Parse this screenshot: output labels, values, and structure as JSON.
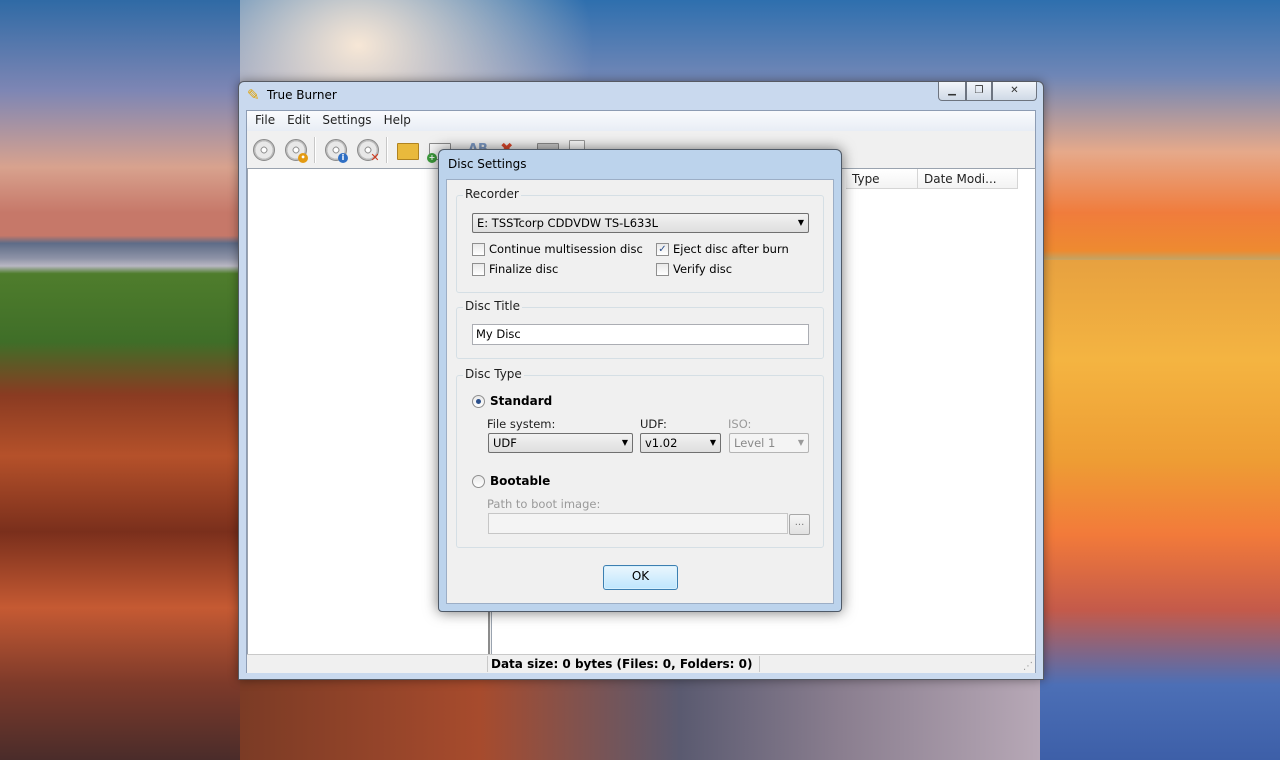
{
  "main_window": {
    "title": "True Burner",
    "menu": [
      "File",
      "Edit",
      "Settings",
      "Help"
    ],
    "toolbar_text": {
      "rename": "AB"
    },
    "columns": {
      "type": "Type",
      "date_modified": "Date Modi..."
    },
    "status": "Data size: 0 bytes (Files: 0, Folders: 0)"
  },
  "dialog": {
    "title": "Disc Settings",
    "recorder": {
      "label": "Recorder",
      "device": "E: TSSTcorp CDDVDW TS-L633L",
      "continue_multisession": "Continue multisession disc",
      "eject_after_burn": "Eject disc after burn",
      "finalize": "Finalize disc",
      "verify": "Verify disc"
    },
    "disc_title": {
      "label": "Disc Title",
      "value": "My Disc"
    },
    "disc_type": {
      "label": "Disc Type",
      "standard": "Standard",
      "file_system_label": "File system:",
      "file_system_value": "UDF",
      "udf_label": "UDF:",
      "udf_value": "v1.02",
      "iso_label": "ISO:",
      "iso_value": "Level 1",
      "bootable": "Bootable",
      "boot_path_label": "Path to boot image:",
      "boot_path_value": "",
      "browse": "..."
    },
    "ok": "OK"
  },
  "state": {
    "continue_multisession": false,
    "eject_after_burn": true,
    "finalize": false,
    "verify": false,
    "disc_type_selected": "standard"
  },
  "icons": {
    "app": "burner-pen-icon",
    "check": "✓",
    "dropdown": "▼"
  }
}
